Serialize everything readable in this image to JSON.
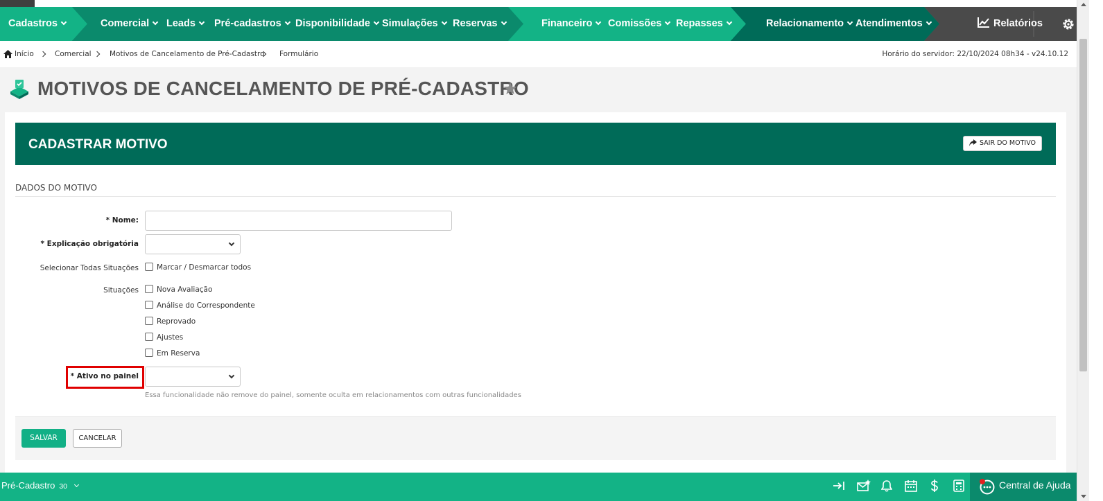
{
  "nav": {
    "items": [
      {
        "label": "Cadastros"
      },
      {
        "label": "Comercial"
      },
      {
        "label": "Leads"
      },
      {
        "label": "Pré-cadastros"
      },
      {
        "label": "Disponibilidade"
      },
      {
        "label": "Simulações"
      },
      {
        "label": "Reservas"
      },
      {
        "label": "Financeiro"
      },
      {
        "label": "Comissões"
      },
      {
        "label": "Repasses"
      },
      {
        "label": "Relacionamento"
      },
      {
        "label": "Atendimentos"
      }
    ],
    "reports_label": "Relatórios",
    "colors": {
      "dark": "#006b58",
      "mid": "#0b8a6c",
      "light": "#13b386",
      "gray": "#4a4a4a"
    }
  },
  "breadcrumb": {
    "items": [
      "Início",
      "Comercial",
      "Motivos de Cancelamento de Pré-Cadastro",
      "Formulário"
    ],
    "server_time": "Horário do servidor: 22/10/2024 08h34 - v24.10.12"
  },
  "page": {
    "title": "MOTIVOS DE CANCELAMENTO DE PRÉ-CADASTRO"
  },
  "card": {
    "header_title": "CADASTRAR MOTIVO",
    "exit_label": "SAIR DO MOTIVO",
    "section_title": "DADOS DO MOTIVO"
  },
  "form": {
    "nome_label": "Nome:",
    "explicacao_label": "Explicação obrigatória",
    "selecionar_label": "Selecionar Todas Situações",
    "marcar_label": "Marcar / Desmarcar todos",
    "situacoes_label": "Situações",
    "situacoes": [
      "Nova Avaliação",
      "Análise do Correspondente",
      "Reprovado",
      "Ajustes",
      "Em Reserva"
    ],
    "ativo_label": "Ativo no painel",
    "ativo_hint": "Essa funcionalidade não remove do painel, somente oculta em relacionamentos com outras funcionalidades",
    "required_mark": "*",
    "save_label": "SALVAR",
    "cancel_label": "CANCELAR"
  },
  "bottombar": {
    "module_label": "Pré-Cadastro",
    "count": "30",
    "help_label": "Central de Ajuda"
  }
}
